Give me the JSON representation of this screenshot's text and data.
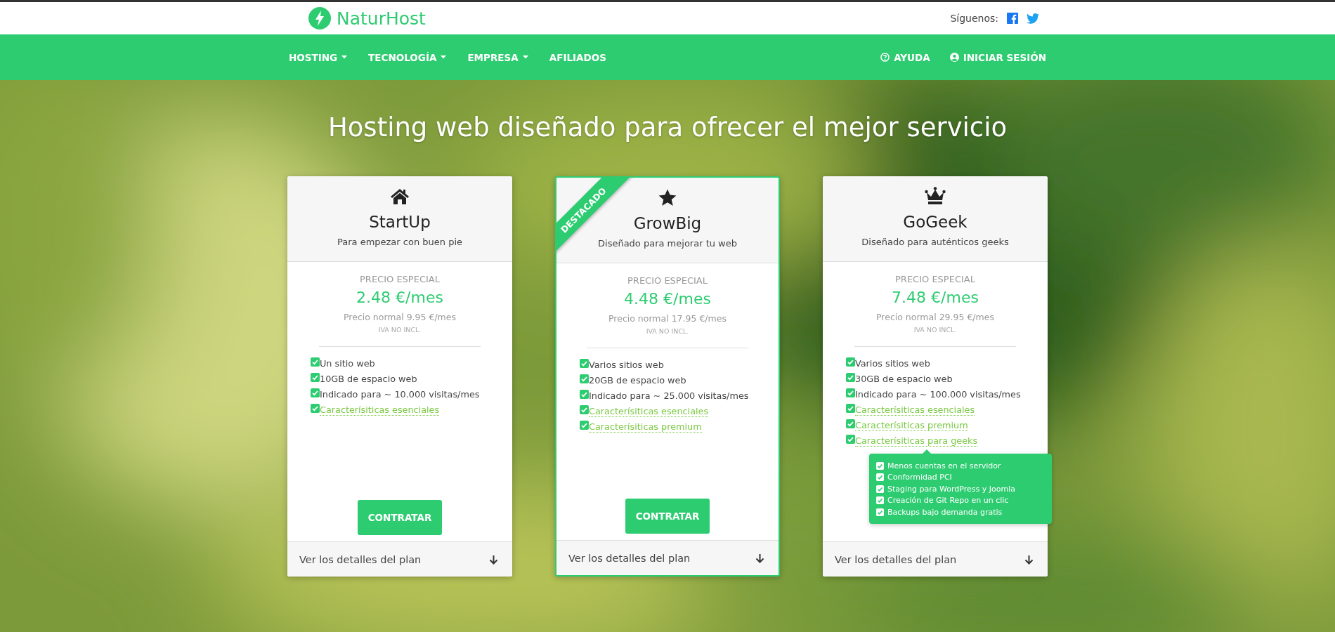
{
  "header": {
    "logo": "NaturHost",
    "follow_label": "Síguenos:"
  },
  "nav": {
    "items": [
      {
        "label": "HOSTING",
        "dropdown": true
      },
      {
        "label": "TECNOLOGÍA",
        "dropdown": true
      },
      {
        "label": "EMPRESA",
        "dropdown": true
      },
      {
        "label": "AFILIADOS",
        "dropdown": false
      }
    ],
    "right_items": [
      {
        "label": "AYUDA"
      },
      {
        "label": "INICIAR SESIÓN"
      }
    ]
  },
  "hero": {
    "title": "Hosting web diseñado para ofrecer el mejor servicio"
  },
  "plans": [
    {
      "name": "StartUp",
      "tagline": "Para empezar con buen pie",
      "featured": false,
      "price_label": "PRECIO ESPECIAL",
      "price": "2.48 €/mes",
      "normal_price": "Precio normal 9.95 €/mes",
      "tax_note": "IVA NO INCL.",
      "features": [
        {
          "kind": "text",
          "text": "Un sitio web",
          "checked": true
        },
        {
          "kind": "text",
          "text": "10GB de espacio web",
          "checked": true
        },
        {
          "kind": "text",
          "text": "Indicado para ~ 10.000 visitas/mes",
          "checked": true
        },
        {
          "kind": "link",
          "text": "Caracterísiticas esenciales",
          "checked": true
        }
      ],
      "button": "CONTRATAR",
      "details_link": "Ver los detalles del plan"
    },
    {
      "name": "GrowBig",
      "tagline": "Diseñado para mejorar tu web",
      "featured": true,
      "ribbon": "DESTACADO",
      "price_label": "PRECIO ESPECIAL",
      "price": "4.48 €/mes",
      "normal_price": "Precio normal 17.95 €/mes",
      "tax_note": "IVA NO INCL.",
      "features": [
        {
          "kind": "text",
          "text": "Varios sitios web",
          "checked": true
        },
        {
          "kind": "text",
          "text": "20GB de espacio web",
          "checked": true
        },
        {
          "kind": "text",
          "text": "Indicado para ~ 25.000 visitas/mes",
          "checked": true
        },
        {
          "kind": "link",
          "text": "Caracterísiticas esenciales",
          "checked": true
        },
        {
          "kind": "link",
          "text": "Caracterísiticas premium",
          "checked": true
        }
      ],
      "button": "CONTRATAR",
      "details_link": "Ver los detalles del plan"
    },
    {
      "name": "GoGeek",
      "tagline": "Diseñado para auténticos geeks",
      "featured": false,
      "price_label": "PRECIO ESPECIAL",
      "price": "7.48 €/mes",
      "normal_price": "Precio normal 29.95 €/mes",
      "tax_note": "IVA NO INCL.",
      "features": [
        {
          "kind": "text",
          "text": "Varios sitios web",
          "checked": true
        },
        {
          "kind": "text",
          "text": "30GB de espacio web",
          "checked": true
        },
        {
          "kind": "text",
          "text": "Indicado para ~ 100.000 visitas/mes",
          "checked": true
        },
        {
          "kind": "link",
          "text": "Caracterísiticas esenciales",
          "checked": true
        },
        {
          "kind": "link",
          "text": "Caracterísiticas premium",
          "checked": true
        },
        {
          "kind": "link",
          "text": "Caracterísiticas para geeks",
          "checked": true,
          "tooltip": [
            {
              "text": "Menos cuentas en el servidor",
              "checked": true
            },
            {
              "text": "Conformidad PCI",
              "checked": true
            },
            {
              "text": "Staging para WordPress y Joomla",
              "checked": true
            },
            {
              "text": "Creación de Git Repo en un clic",
              "checked": true
            },
            {
              "text": "Backups bajo demanda gratis",
              "checked": true
            }
          ]
        }
      ],
      "details_link": "Ver los detalles del plan"
    }
  ]
}
